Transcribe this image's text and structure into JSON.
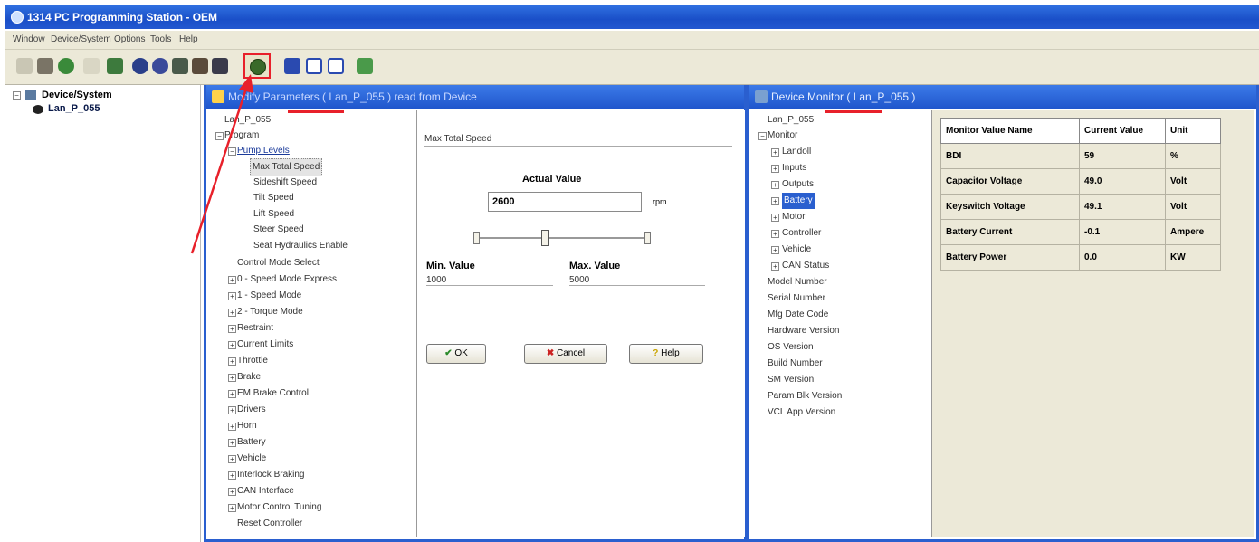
{
  "app": {
    "title": "1314 PC Programming Station - OEM"
  },
  "menu": [
    "Window",
    "Device/System",
    "Options",
    "Tools",
    "Help"
  ],
  "toolbar": {
    "icons": [
      "connect-icon",
      "disconnect-icon",
      "refresh-icon",
      "print-icon",
      "settings-icon",
      "program-icon",
      "monitor-icon",
      "faults-icon",
      "log-icon",
      "parameters-icon",
      "window-icon",
      "save-icon",
      "grid-icon",
      "export-icon"
    ]
  },
  "left_tree": {
    "root": "Device/System",
    "child": "Lan_P_055"
  },
  "param_window": {
    "title": "Modify Parameters ( Lan_P_055 ) read from Device",
    "tree": {
      "root": "Lan_P_055",
      "program": "Program",
      "pump_levels": "Pump Levels",
      "pump_children": [
        "Max Total Speed",
        "Sideshift Speed",
        "Tilt Speed",
        "Lift Speed",
        "Steer Speed",
        "Seat Hydraulics Enable"
      ],
      "items": [
        "Control Mode Select",
        "0 - Speed Mode Express",
        "1 - Speed Mode",
        "2 - Torque Mode",
        "Restraint",
        "Current Limits",
        "Throttle",
        "Brake",
        "EM Brake Control",
        "Drivers",
        "Horn",
        "Battery",
        "Vehicle",
        "Interlock Braking",
        "CAN Interface",
        "Motor Control Tuning",
        "Reset Controller"
      ]
    },
    "editor": {
      "param_name": "Max Total Speed",
      "actual_label": "Actual Value",
      "actual_value": "2600",
      "unit": "rpm",
      "min_label": "Min. Value",
      "max_label": "Max. Value",
      "min_value": "1000",
      "max_value": "5000",
      "slider_fraction": 0.4,
      "ok": "OK",
      "cancel": "Cancel",
      "help": "Help"
    }
  },
  "monitor_window": {
    "title": "Device Monitor ( Lan_P_055 )",
    "tree": {
      "root": "Lan_P_055",
      "monitor": "Monitor",
      "monitor_children": [
        "Landoll",
        "Inputs",
        "Outputs",
        "Battery",
        "Motor",
        "Controller",
        "Vehicle",
        "CAN Status"
      ],
      "info": [
        "Model Number",
        "Serial Number",
        "Mfg Date Code",
        "Hardware Version",
        "OS Version",
        "Build Number",
        "SM Version",
        "Param Blk Version",
        "VCL App Version"
      ]
    },
    "table": {
      "headers": [
        "Monitor Value Name",
        "Current Value",
        "Unit"
      ],
      "rows": [
        [
          "BDI",
          "59",
          "%"
        ],
        [
          "Capacitor Voltage",
          "49.0",
          "Volt"
        ],
        [
          "Keyswitch Voltage",
          "49.1",
          "Volt"
        ],
        [
          "Battery Current",
          "-0.1",
          "Ampere"
        ],
        [
          "Battery Power",
          "0.0",
          "KW"
        ]
      ]
    }
  },
  "colors": {
    "title": "#1a4fc8",
    "highlight": "#e8202a",
    "toolbar": "#ece9d8"
  }
}
